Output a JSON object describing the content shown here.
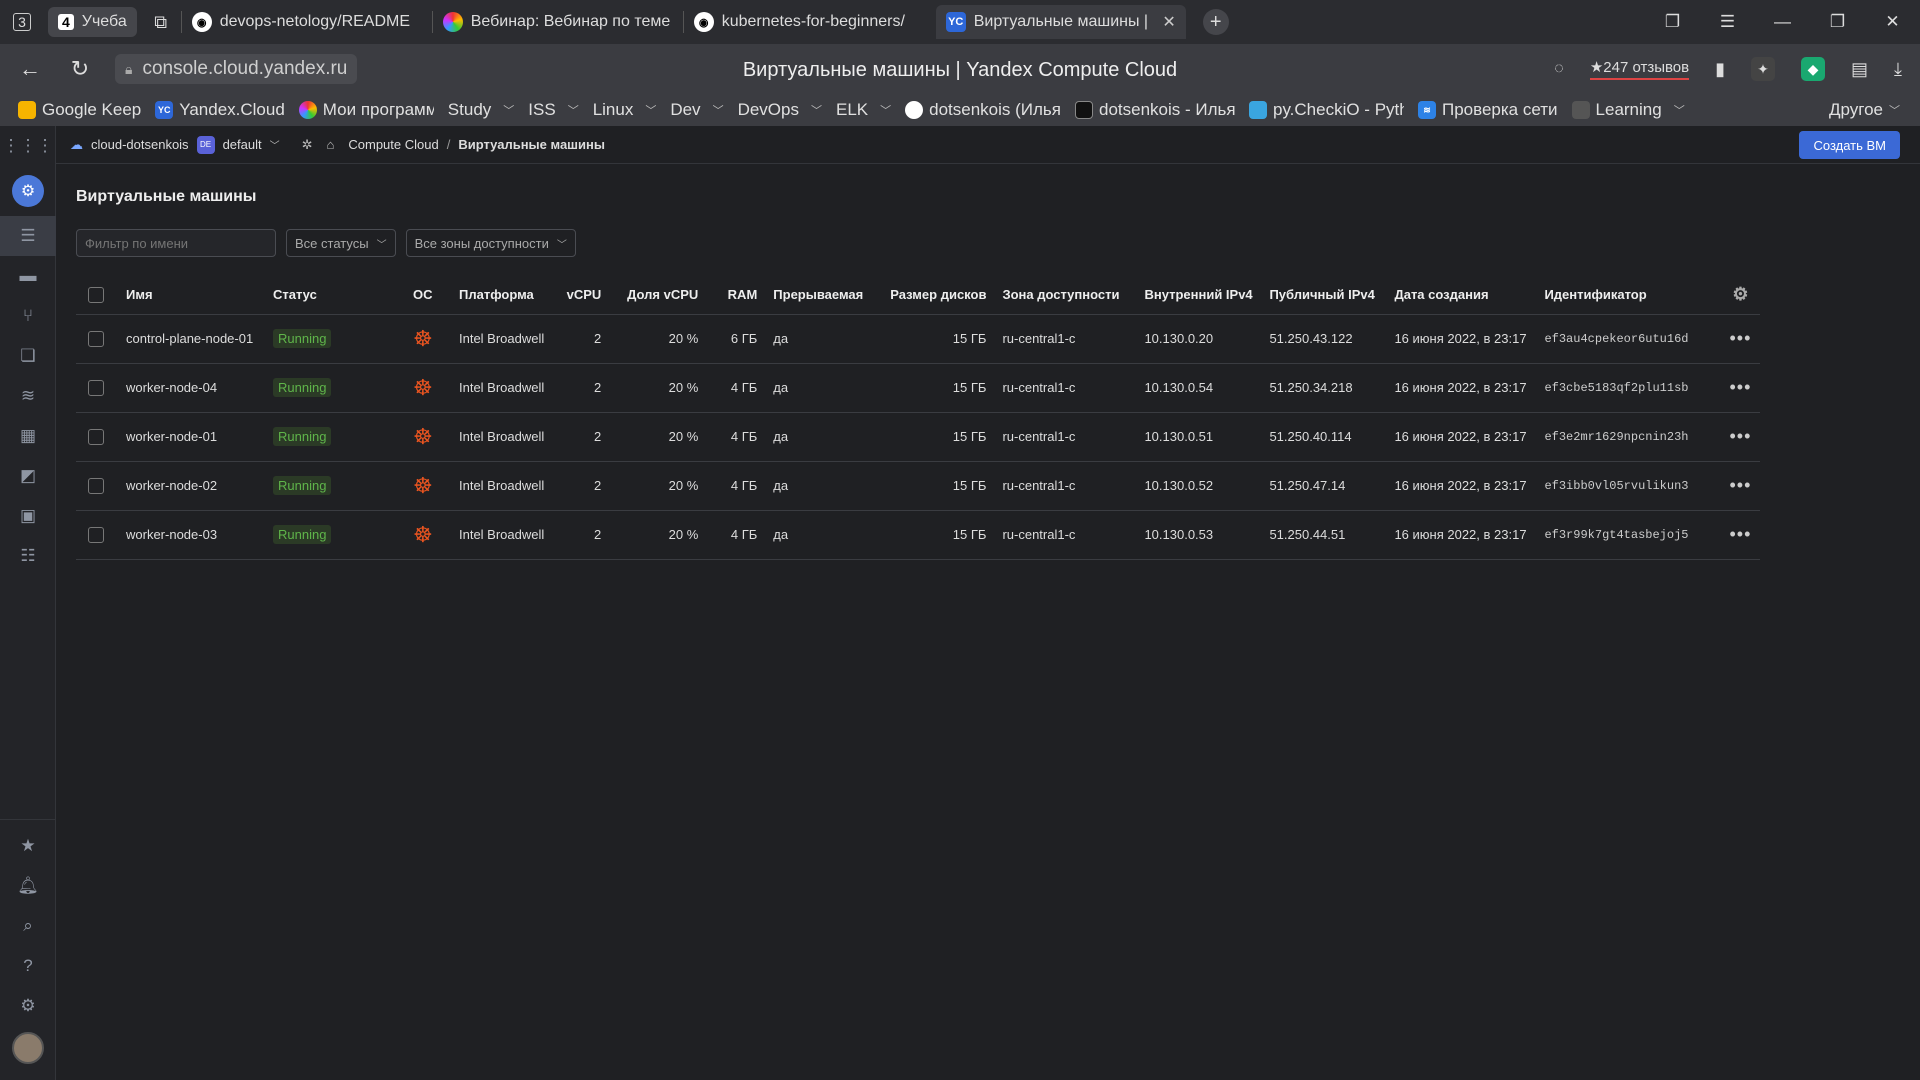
{
  "tabs": {
    "tab_count": "3",
    "group": {
      "count": "4",
      "label": "Учеба"
    },
    "items": [
      {
        "title": "devops-netology/README",
        "icon": "github-icon"
      },
      {
        "title": "Вебинар: Вебинар по теме",
        "icon": "netology-icon"
      },
      {
        "title": "kubernetes-for-beginners/",
        "icon": "github-icon"
      },
      {
        "title": "Виртуальные машины |",
        "icon": "yc-icon",
        "fav_text": "YC"
      }
    ],
    "close_glyph": "✕",
    "new_tab_glyph": "+"
  },
  "address": {
    "url": "console.cloud.yandex.ru",
    "page_title": "Виртуальные машины | Yandex Compute Cloud",
    "reviews": "★247 отзывов"
  },
  "bookmarks": [
    {
      "label": "Google Keep",
      "color": "#f6b400",
      "has_menu": false
    },
    {
      "label": "Yandex.Cloud",
      "color": "#2d67d8",
      "fav": "YC",
      "has_menu": false
    },
    {
      "label": "Мои программы",
      "color": "#c34ad8",
      "has_menu": false
    },
    {
      "label": "Study",
      "has_menu": true
    },
    {
      "label": "ISS",
      "has_menu": true
    },
    {
      "label": "Linux",
      "has_menu": true
    },
    {
      "label": "Dev",
      "has_menu": true
    },
    {
      "label": "DevOps",
      "has_menu": true
    },
    {
      "label": "ELK",
      "has_menu": true
    },
    {
      "label": "dotsenkois (Илья",
      "color": "#ffffff",
      "has_menu": false
    },
    {
      "label": "dotsenkois - Илья",
      "color": "#111111",
      "has_menu": false
    },
    {
      "label": "py.CheckiO - Pyth",
      "color": "#3aa5e0",
      "has_menu": false
    },
    {
      "label": "Проверка сети",
      "color": "#2d82e6",
      "has_menu": false
    },
    {
      "label": "Learning",
      "has_menu": true
    }
  ],
  "bookmarks_other": "Другое",
  "breadcrumbs": {
    "cloud": "cloud-dotsenkois",
    "folder_badge": "DE",
    "folder": "default",
    "service": "Compute Cloud",
    "separator": "/",
    "current": "Виртуальные машины",
    "create_button": "Создать ВМ"
  },
  "main": {
    "title": "Виртуальные машины",
    "filter_placeholder": "Фильтр по имени",
    "status_select": "Все статусы",
    "zone_select": "Все зоны доступности",
    "columns": [
      "Имя",
      "Статус",
      "ОС",
      "Платформа",
      "vCPU",
      "Доля vCPU",
      "RAM",
      "Прерываемая",
      "Размер дисков",
      "Зона доступности",
      "Внутренний IPv4",
      "Публичный IPv4",
      "Дата создания",
      "Идентификатор"
    ],
    "rows": [
      {
        "name": "control-plane-node-01",
        "status": "Running",
        "platform": "Intel Broadwell",
        "vcpu": "2",
        "share": "20 %",
        "ram": "6 ГБ",
        "preemptible": "да",
        "disk": "15 ГБ",
        "zone": "ru-central1-c",
        "internal_ip": "10.130.0.20",
        "public_ip": "51.250.43.122",
        "created": "16 июня 2022, в 23:17",
        "id": "ef3au4cpekeor6utu16d"
      },
      {
        "name": "worker-node-04",
        "status": "Running",
        "platform": "Intel Broadwell",
        "vcpu": "2",
        "share": "20 %",
        "ram": "4 ГБ",
        "preemptible": "да",
        "disk": "15 ГБ",
        "zone": "ru-central1-c",
        "internal_ip": "10.130.0.54",
        "public_ip": "51.250.34.218",
        "created": "16 июня 2022, в 23:17",
        "id": "ef3cbe5183qf2plu11sb"
      },
      {
        "name": "worker-node-01",
        "status": "Running",
        "platform": "Intel Broadwell",
        "vcpu": "2",
        "share": "20 %",
        "ram": "4 ГБ",
        "preemptible": "да",
        "disk": "15 ГБ",
        "zone": "ru-central1-c",
        "internal_ip": "10.130.0.51",
        "public_ip": "51.250.40.114",
        "created": "16 июня 2022, в 23:17",
        "id": "ef3e2mr1629npcnin23h"
      },
      {
        "name": "worker-node-02",
        "status": "Running",
        "platform": "Intel Broadwell",
        "vcpu": "2",
        "share": "20 %",
        "ram": "4 ГБ",
        "preemptible": "да",
        "disk": "15 ГБ",
        "zone": "ru-central1-c",
        "internal_ip": "10.130.0.52",
        "public_ip": "51.250.47.14",
        "created": "16 июня 2022, в 23:17",
        "id": "ef3ibb0vl05rvulikun3"
      },
      {
        "name": "worker-node-03",
        "status": "Running",
        "platform": "Intel Broadwell",
        "vcpu": "2",
        "share": "20 %",
        "ram": "4 ГБ",
        "preemptible": "да",
        "disk": "15 ГБ",
        "zone": "ru-central1-c",
        "internal_ip": "10.130.0.53",
        "public_ip": "51.250.44.51",
        "created": "16 июня 2022, в 23:17",
        "id": "ef3r99k7gt4tasbejoj5"
      }
    ],
    "os_icon": "ubuntu-icon",
    "row_menu_glyph": "•••"
  },
  "colors": {
    "accent": "#3b69d6",
    "running_text": "#5fb54a",
    "ubuntu": "#e95420"
  }
}
